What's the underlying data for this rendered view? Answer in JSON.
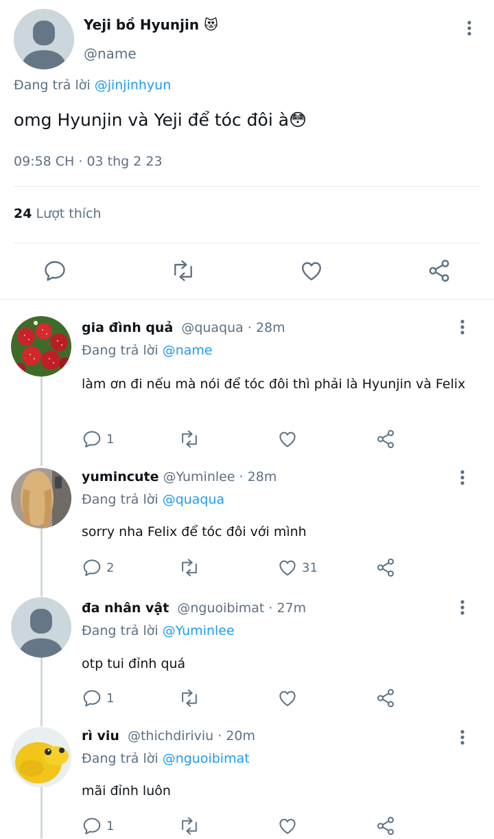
{
  "main_tweet": {
    "display_name": "Yeji bồ Hyunjin 😻",
    "handle": "@name",
    "replying_prefix": "Đang trả lời",
    "replying_to": "@jinjinhyun",
    "text": "omg Hyunjin và Yeji để tóc đôi à😳",
    "timestamp": "09:58 CH · 03 thg 2 23",
    "likes_count": "24",
    "likes_label": "Lượt thích"
  },
  "replies": [
    {
      "display_name": "gia đình quả",
      "meta": "@quaqua · 28m",
      "replying_prefix": "Đang trả lời",
      "replying_to": "@name",
      "text": "làm ơn đi nếu mà nói để tóc đôi thì phải là Hyunjin và Felix",
      "reply_count": "1",
      "like_count": ""
    },
    {
      "display_name": "yumincute",
      "meta": "@Yuminlee · 28m",
      "replying_prefix": "Đang trả lời",
      "replying_to": "@quaqua",
      "text": "sorry nha Felix để tóc đôi với mình",
      "reply_count": "2",
      "like_count": "31"
    },
    {
      "display_name": "đa nhân vật",
      "meta": "@nguoibimat · 27m",
      "replying_prefix": "Đang trả lời",
      "replying_to": "@Yuminlee",
      "text": "otp tui đỉnh quá",
      "reply_count": "1",
      "like_count": ""
    },
    {
      "display_name": "rì viu",
      "meta": "@thichdiriviu · 20m",
      "replying_prefix": "Đang trả lời",
      "replying_to": "@nguoibimat",
      "text": "mãi đỉnh luôn",
      "reply_count": "1",
      "like_count": ""
    }
  ],
  "colors": {
    "accent": "#1d9bf0",
    "secondary_text": "#5b7083",
    "icon": "#5b7083",
    "divider": "#e6ecf0"
  }
}
